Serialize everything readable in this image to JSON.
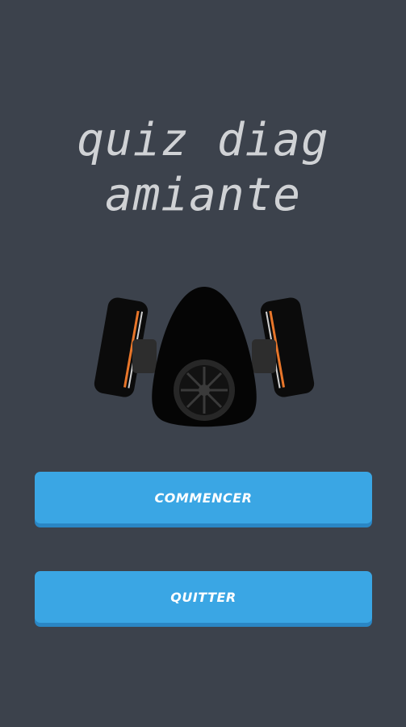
{
  "title": {
    "line1": "quiz diag",
    "line2": "amiante"
  },
  "illustration": {
    "icon": "respirator-mask-icon"
  },
  "buttons": {
    "start_label": "COMMENCER",
    "quit_label": "QUITTER"
  },
  "colors": {
    "background": "#3c424c",
    "title": "#d0d2d5",
    "button": "#3aa6e4",
    "button_shadow": "#2a86c4",
    "filter_stripe": "#e8762a"
  }
}
